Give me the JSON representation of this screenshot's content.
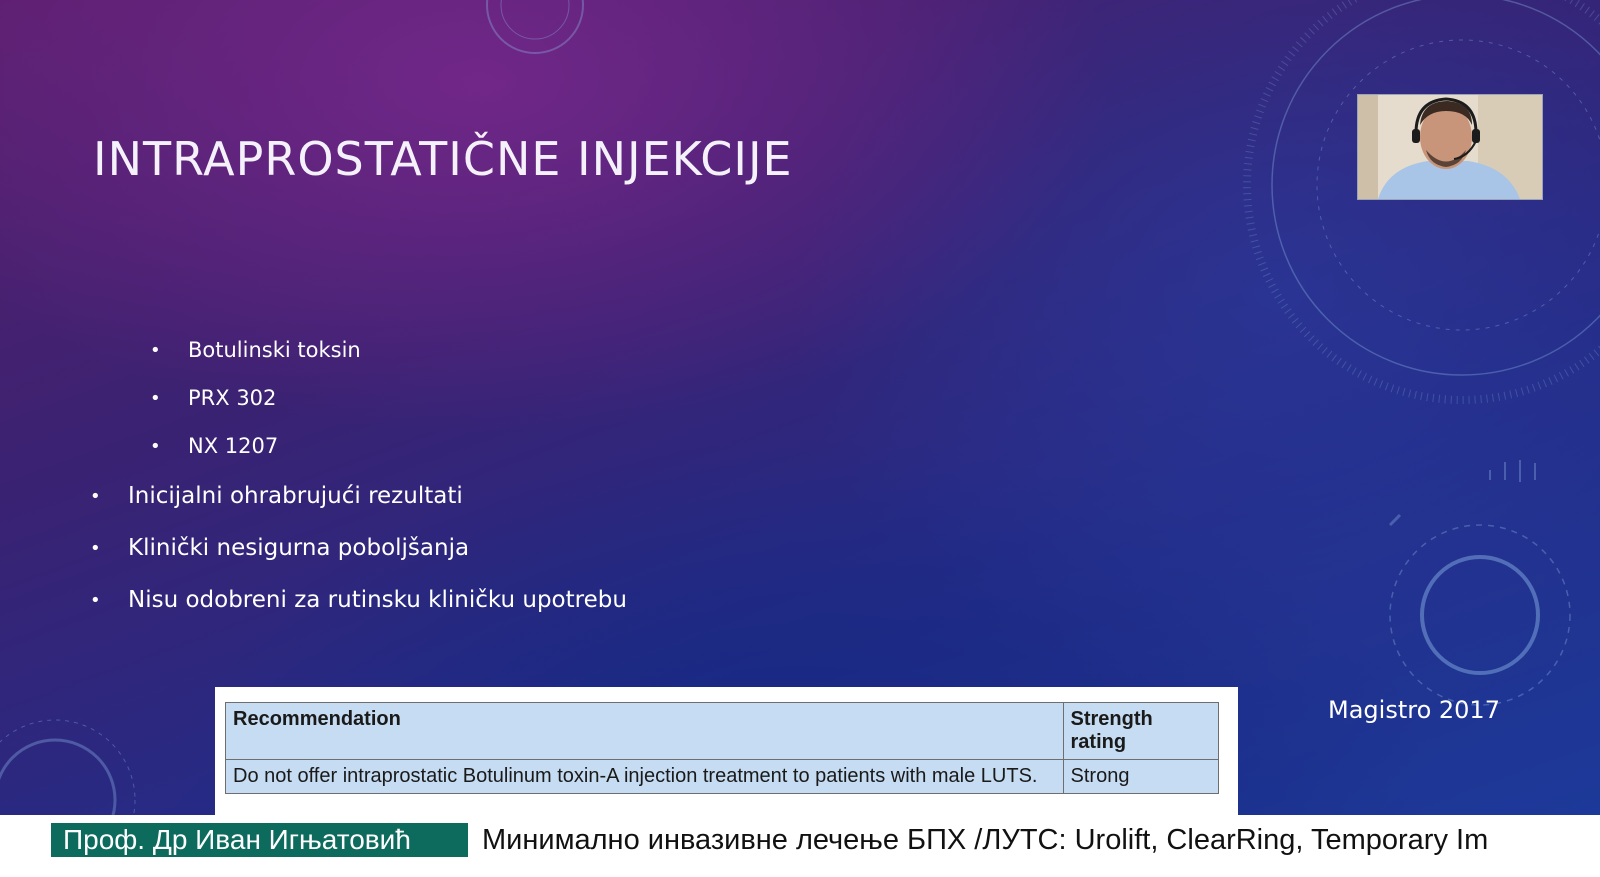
{
  "slide": {
    "title": "INTRAPROSTATIČNE INJEKCIJE",
    "sub_bullets": [
      "Botulinski toksin",
      "PRX 302",
      "NX 1207"
    ],
    "main_bullets": [
      "Inicijalni ohrabrujući rezultati",
      "Klinički nesigurna poboljšanja",
      "Nisu odobreni za rutinsku kliničku upotrebu"
    ],
    "bullet_glyph": "•",
    "credit": "Magistro 2017",
    "background_colors": [
      "#5a1f6e",
      "#252b86",
      "#1c3a9a"
    ]
  },
  "table": {
    "headers": [
      "Recommendation",
      "Strength rating"
    ],
    "rows": [
      [
        "Do not offer intraprostatic Botulinum toxin-A injection treatment to patients with male LUTS.",
        "Strong"
      ]
    ],
    "header_bg": "#c6dcf2"
  },
  "webcam": {
    "icon": "presenter-video-feed"
  },
  "ticker": {
    "speaker": "Проф. Др Иван Игњатовић",
    "headline": "Минимално инвазивне лечење БПХ /ЛУТС: Urolift, ClearRing, Temporary Im",
    "tag_color": "#0d6b5e"
  }
}
